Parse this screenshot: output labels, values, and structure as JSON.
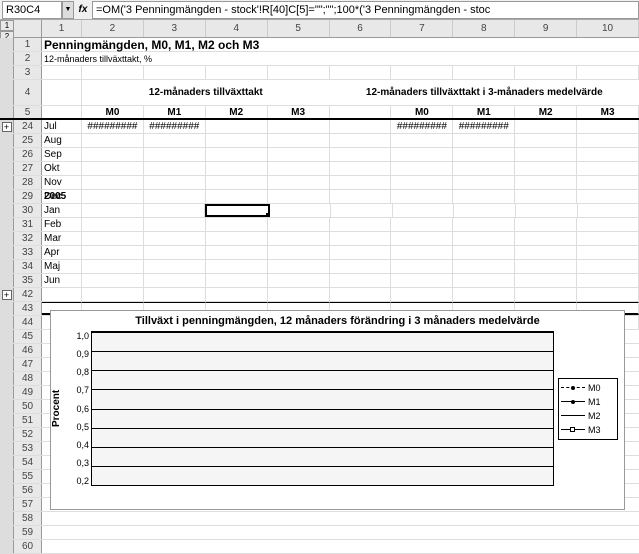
{
  "namebox": "R30C4",
  "formula": "=OM('3 Penningmängden - stock'!R[40]C[5]=\"\";\"\";100*('3 Penningmängden - stoc",
  "outline_levels": [
    "1",
    "2"
  ],
  "cols": [
    "1",
    "2",
    "3",
    "4",
    "5",
    "6",
    "7",
    "8",
    "9",
    "10"
  ],
  "rows": {
    "r1_num": "1",
    "r1_title": "Penningmängden, M0, M1, M2 och M3",
    "r2_num": "2",
    "r2_sub": "12-månaders tillväxttakt, %",
    "r3_num": "3",
    "r4_num": "4",
    "r4_h1": "12-månaders tillväxttakt",
    "r4_h2": "12-månaders tillväxttakt i 3-månaders medelvärde",
    "r5_num": "5",
    "m0": "M0",
    "m1": "M1",
    "m2": "M2",
    "m3": "M3",
    "r24_num": "24",
    "r24_lab": "Jul",
    "ov": "#########",
    "r25_num": "25",
    "r25_lab": "Aug",
    "r26_num": "26",
    "r26_lab": "Sep",
    "r27_num": "27",
    "r27_lab": "Okt",
    "r28_num": "28",
    "r28_lab": "Nov",
    "r29_num": "29",
    "r29_lab": "Dec",
    "r30_num": "30",
    "r30_lab": "Jan",
    "r30_year": "2005",
    "r31_num": "31",
    "r31_lab": "Feb",
    "r32_num": "32",
    "r32_lab": "Mar",
    "r33_num": "33",
    "r33_lab": "Apr",
    "r34_num": "34",
    "r34_lab": "Maj",
    "r35_num": "35",
    "r35_lab": "Jun",
    "r42_num": "42",
    "r43_num": "43",
    "r44_num": "44",
    "r45_num": "45",
    "r46_num": "46",
    "r47_num": "47",
    "r48_num": "48",
    "r49_num": "49",
    "r50_num": "50",
    "r51_num": "51",
    "r52_num": "52",
    "r53_num": "53",
    "r54_num": "54",
    "r55_num": "55",
    "r56_num": "56",
    "r57_num": "57",
    "r58_num": "58",
    "r59_num": "59",
    "r60_num": "60"
  },
  "chart_data": {
    "type": "line",
    "title": "Tillväxt i penningmängden, 12 månaders förändring i 3 månaders medelvärde",
    "ylabel": "Procent",
    "ylim": [
      0.2,
      1.0
    ],
    "yticks": [
      "1,0",
      "0,9",
      "0,8",
      "0,7",
      "0,6",
      "0,5",
      "0,4",
      "0,3",
      "0,2"
    ],
    "series": [
      {
        "name": "M0"
      },
      {
        "name": "M1"
      },
      {
        "name": "M2"
      },
      {
        "name": "M3"
      }
    ]
  }
}
